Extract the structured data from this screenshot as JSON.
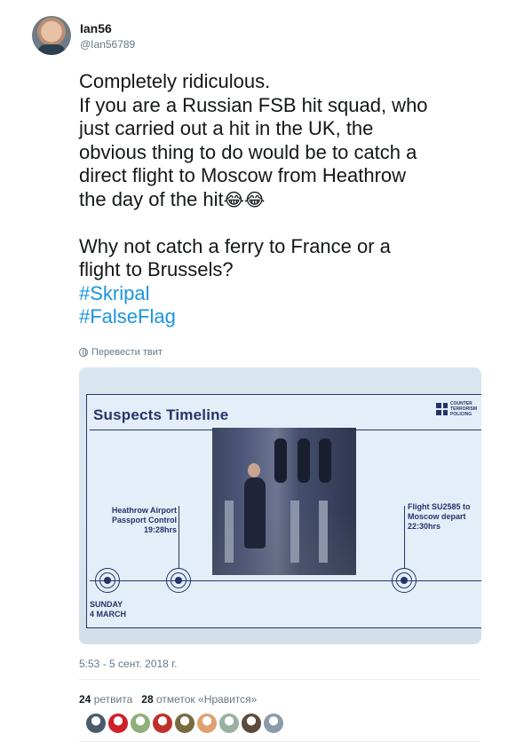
{
  "author": {
    "display_name": "Ian56",
    "handle": "@Ian56789"
  },
  "tweet": {
    "lines": [
      "Completely ridiculous.",
      "If you are a Russian FSB hit squad, who",
      "just carried out a hit in the UK, the",
      "obvious thing to do would be to catch a",
      "direct flight to Moscow from Heathrow",
      "the day of the hit"
    ],
    "emoji": "😂😂",
    "lines2": [
      "Why not catch a ferry to France or a",
      "flight to Brussels?"
    ],
    "hashtags": [
      "#Skripal",
      "#FalseFlag"
    ],
    "translate_label": "Перевести твит"
  },
  "media": {
    "slide_title": "Suspects Timeline",
    "logo_text": [
      "COUNTER",
      "TERRORISM",
      "POLICING"
    ],
    "labels": {
      "heathrow": [
        "Heathrow Airport",
        "Passport Control",
        "19:28hrs"
      ],
      "flight": [
        "Flight SU2585 to",
        "Moscow depart",
        "22:30hrs"
      ],
      "date": [
        "SUNDAY",
        "4 MARCH"
      ]
    }
  },
  "meta": {
    "timestamp": "5:53 - 5 сент. 2018 г."
  },
  "stats": {
    "retweets_count": "24",
    "retweets_label": "ретвита",
    "likes_count": "28",
    "likes_label": "отметок «Нравится»"
  },
  "likers": [
    {
      "name": "liker-avatar-1",
      "color": "#4a5a6a"
    },
    {
      "name": "liker-avatar-2",
      "color": "#d0202a"
    },
    {
      "name": "liker-avatar-3",
      "color": "#8fb07a"
    },
    {
      "name": "liker-avatar-4",
      "color": "#c0302a"
    },
    {
      "name": "liker-avatar-5",
      "color": "#7a6a40"
    },
    {
      "name": "liker-avatar-6",
      "color": "#e0a070"
    },
    {
      "name": "liker-avatar-7",
      "color": "#9ab0a0"
    },
    {
      "name": "liker-avatar-8",
      "color": "#5a4a3a"
    },
    {
      "name": "liker-avatar-9",
      "color": "#8a9aa8"
    }
  ]
}
